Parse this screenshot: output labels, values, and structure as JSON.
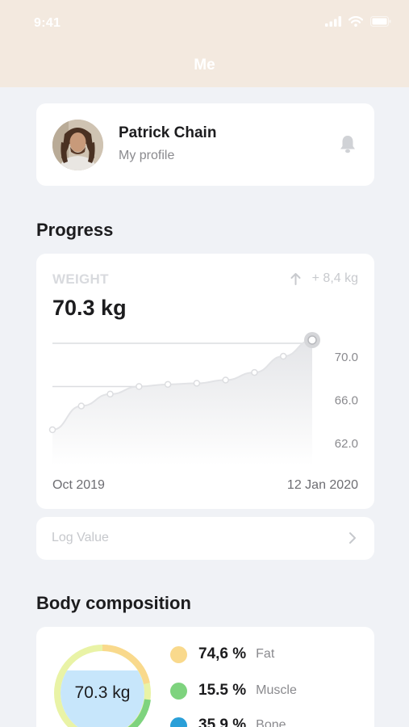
{
  "status_bar": {
    "time": "9:41"
  },
  "header": {
    "title": "Me"
  },
  "profile": {
    "name": "Patrick Chain",
    "subtitle": "My profile"
  },
  "progress": {
    "section_title": "Progress",
    "weight_label": "WEIGHT",
    "delta": "+ 8,4 kg",
    "current_value": "70.3 kg",
    "y_ticks": [
      "70.0",
      "66.0",
      "62.0"
    ],
    "date_start": "Oct 2019",
    "date_end": "12 Jan 2020"
  },
  "chart_data": {
    "type": "area",
    "y_ticks": [
      70.0,
      66.0,
      62.0
    ],
    "ylim": [
      62.0,
      70.0
    ],
    "x_labels": [
      "Oct 2019",
      "12 Jan 2020"
    ],
    "values": [
      62.0,
      64.2,
      65.3,
      66.0,
      66.2,
      66.3,
      66.6,
      67.3,
      68.8,
      70.3
    ],
    "accent_color": "#c7c7cc"
  },
  "log": {
    "label": "Log Value"
  },
  "body_composition": {
    "section_title": "Body composition",
    "center_value": "70.3 kg",
    "items": [
      {
        "value": "74,6 %",
        "label": "Fat",
        "color": "#f9d98c"
      },
      {
        "value": "15.5 %",
        "label": "Muscle",
        "color": "#7ed37e"
      },
      {
        "value": "35.9 %",
        "label": "Bone",
        "color": "#2a9fd8"
      }
    ]
  }
}
